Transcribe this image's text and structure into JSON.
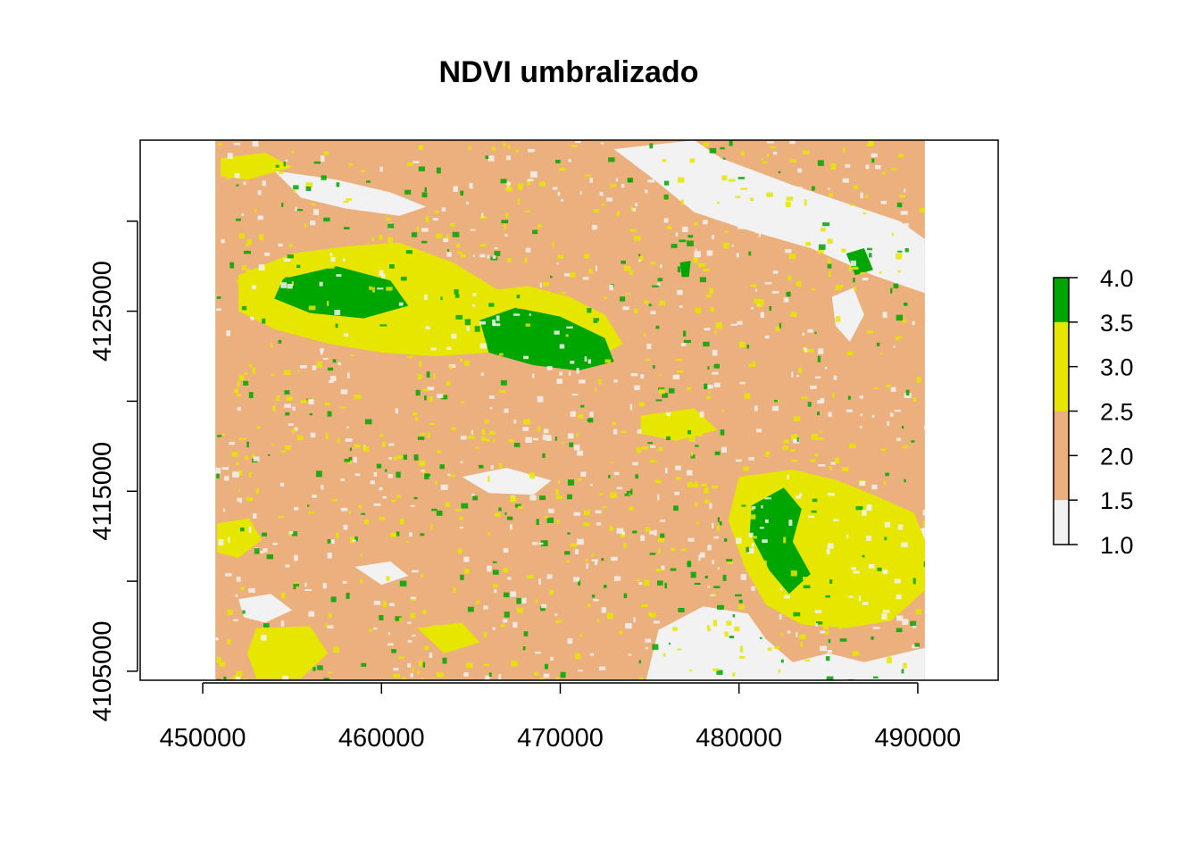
{
  "chart_data": {
    "type": "heatmap",
    "title": "NDVI umbralizado",
    "xlabel": "",
    "ylabel": "",
    "xlim": [
      446500,
      494500
    ],
    "ylim": [
      4104500,
      4134500
    ],
    "raster_extent": {
      "x": [
        450700,
        490400
      ],
      "y": [
        4104500,
        4134500
      ]
    },
    "x_ticks": [
      450000,
      460000,
      470000,
      480000,
      490000
    ],
    "y_ticks": [
      4105000,
      4110000,
      4115000,
      4120000,
      4125000,
      4130000
    ],
    "y_tick_labels": [
      4105000,
      4115000,
      4125000
    ],
    "grid": false,
    "legend": {
      "placement": "right",
      "range": [
        1.0,
        4.0
      ],
      "tick_values": [
        "4.0",
        "3.5",
        "3.0",
        "2.5",
        "2.0",
        "1.5",
        "1.0"
      ],
      "classes": [
        {
          "from": 1.0,
          "to": 1.5,
          "color": "#f2f2f2"
        },
        {
          "from": 1.5,
          "to": 2.5,
          "color": "#ebb07d"
        },
        {
          "from": 2.5,
          "to": 3.5,
          "color": "#e6e600"
        },
        {
          "from": 3.5,
          "to": 4.0,
          "color": "#00a600"
        }
      ]
    },
    "regions": [
      {
        "class": 1,
        "points": [
          [
            477500,
            4134500
          ],
          [
            479000,
            4133500
          ],
          [
            483000,
            4132000
          ],
          [
            486000,
            4131000
          ],
          [
            489000,
            4130000
          ],
          [
            490400,
            4129000
          ],
          [
            490400,
            4126000
          ],
          [
            487500,
            4127000
          ],
          [
            484000,
            4128500
          ],
          [
            480500,
            4129500
          ],
          [
            477500,
            4130500
          ],
          [
            475000,
            4132500
          ],
          [
            473000,
            4134000
          ]
        ]
      },
      {
        "class": 1,
        "points": [
          [
            474800,
            4104500
          ],
          [
            475500,
            4107300
          ],
          [
            478000,
            4108600
          ],
          [
            480500,
            4108200
          ],
          [
            481500,
            4106800
          ],
          [
            483000,
            4105500
          ],
          [
            485000,
            4106000
          ],
          [
            487000,
            4105500
          ],
          [
            490400,
            4106300
          ],
          [
            490400,
            4104500
          ]
        ]
      },
      {
        "class": 1,
        "points": [
          [
            490400,
            4110500
          ],
          [
            489500,
            4110800
          ],
          [
            489000,
            4112500
          ],
          [
            490400,
            4113000
          ]
        ]
      },
      {
        "class": 1,
        "points": [
          [
            454000,
            4132800
          ],
          [
            457500,
            4132300
          ],
          [
            460500,
            4131600
          ],
          [
            462500,
            4130800
          ],
          [
            461000,
            4130300
          ],
          [
            458000,
            4130700
          ],
          [
            455500,
            4131300
          ]
        ]
      },
      {
        "class": 1,
        "points": [
          [
            464500,
            4115800
          ],
          [
            467000,
            4116300
          ],
          [
            469500,
            4115600
          ],
          [
            468500,
            4114800
          ],
          [
            466000,
            4114900
          ]
        ]
      },
      {
        "class": 1,
        "points": [
          [
            452000,
            4109000
          ],
          [
            453800,
            4109300
          ],
          [
            455000,
            4108400
          ],
          [
            453500,
            4107700
          ],
          [
            452300,
            4108000
          ]
        ]
      },
      {
        "class": 1,
        "points": [
          [
            458500,
            4110800
          ],
          [
            460500,
            4111100
          ],
          [
            461500,
            4110300
          ],
          [
            460000,
            4109800
          ]
        ]
      },
      {
        "class": 1,
        "points": [
          [
            485200,
            4125800
          ],
          [
            486400,
            4126300
          ],
          [
            487000,
            4124800
          ],
          [
            486200,
            4123300
          ],
          [
            485400,
            4124200
          ]
        ]
      },
      {
        "class": 3,
        "points": [
          [
            452000,
            4127000
          ],
          [
            455000,
            4128200
          ],
          [
            458000,
            4128600
          ],
          [
            461000,
            4128800
          ],
          [
            464000,
            4127700
          ],
          [
            466500,
            4126200
          ],
          [
            468200,
            4126400
          ],
          [
            470500,
            4125800
          ],
          [
            472500,
            4124800
          ],
          [
            473500,
            4123200
          ],
          [
            472000,
            4122300
          ],
          [
            469000,
            4122400
          ],
          [
            466000,
            4122700
          ],
          [
            463000,
            4122500
          ],
          [
            460000,
            4122700
          ],
          [
            457000,
            4123200
          ],
          [
            454000,
            4124000
          ],
          [
            452000,
            4125000
          ]
        ]
      },
      {
        "class": 3,
        "points": [
          [
            480000,
            4115800
          ],
          [
            483000,
            4116200
          ],
          [
            485500,
            4115600
          ],
          [
            487500,
            4114800
          ],
          [
            489800,
            4113800
          ],
          [
            490400,
            4112300
          ],
          [
            490400,
            4109500
          ],
          [
            488500,
            4107800
          ],
          [
            486000,
            4107400
          ],
          [
            483500,
            4107600
          ],
          [
            481500,
            4108700
          ],
          [
            480300,
            4110800
          ],
          [
            479400,
            4113400
          ]
        ]
      },
      {
        "class": 3,
        "points": [
          [
            450800,
            4113200
          ],
          [
            452600,
            4113500
          ],
          [
            453300,
            4112300
          ],
          [
            452000,
            4111300
          ],
          [
            450800,
            4111600
          ]
        ]
      },
      {
        "class": 3,
        "points": [
          [
            453000,
            4107400
          ],
          [
            456000,
            4107500
          ],
          [
            457000,
            4106000
          ],
          [
            455500,
            4104600
          ],
          [
            453000,
            4104600
          ],
          [
            452500,
            4106000
          ]
        ]
      },
      {
        "class": 3,
        "points": [
          [
            462000,
            4107400
          ],
          [
            464500,
            4107700
          ],
          [
            465500,
            4106600
          ],
          [
            463500,
            4106000
          ]
        ]
      },
      {
        "class": 3,
        "points": [
          [
            451000,
            4133500
          ],
          [
            453500,
            4133800
          ],
          [
            455000,
            4133000
          ],
          [
            452500,
            4132300
          ],
          [
            451000,
            4132500
          ]
        ]
      },
      {
        "class": 3,
        "points": [
          [
            474500,
            4119200
          ],
          [
            477500,
            4119600
          ],
          [
            478800,
            4118400
          ],
          [
            476500,
            4117800
          ],
          [
            474500,
            4118200
          ]
        ]
      },
      {
        "class": 4,
        "points": [
          [
            454500,
            4126800
          ],
          [
            457500,
            4127500
          ],
          [
            460500,
            4126700
          ],
          [
            461500,
            4125300
          ],
          [
            459000,
            4124600
          ],
          [
            456000,
            4124900
          ],
          [
            454000,
            4125700
          ]
        ]
      },
      {
        "class": 4,
        "points": [
          [
            465500,
            4124500
          ],
          [
            467500,
            4125200
          ],
          [
            470000,
            4124700
          ],
          [
            472500,
            4123500
          ],
          [
            473000,
            4122200
          ],
          [
            471000,
            4121700
          ],
          [
            468500,
            4122000
          ],
          [
            466000,
            4122700
          ]
        ]
      },
      {
        "class": 4,
        "points": [
          [
            480700,
            4114200
          ],
          [
            482500,
            4115200
          ],
          [
            483500,
            4114000
          ],
          [
            483000,
            4112200
          ],
          [
            484000,
            4110400
          ],
          [
            482800,
            4109300
          ],
          [
            481700,
            4110600
          ],
          [
            480600,
            4112700
          ]
        ]
      },
      {
        "class": 4,
        "points": [
          [
            476700,
            4127700
          ],
          [
            477300,
            4127800
          ],
          [
            477200,
            4126900
          ],
          [
            476800,
            4126900
          ]
        ]
      },
      {
        "class": 4,
        "points": [
          [
            486000,
            4128200
          ],
          [
            487000,
            4128500
          ],
          [
            487500,
            4127300
          ],
          [
            486500,
            4127000
          ]
        ]
      }
    ]
  }
}
